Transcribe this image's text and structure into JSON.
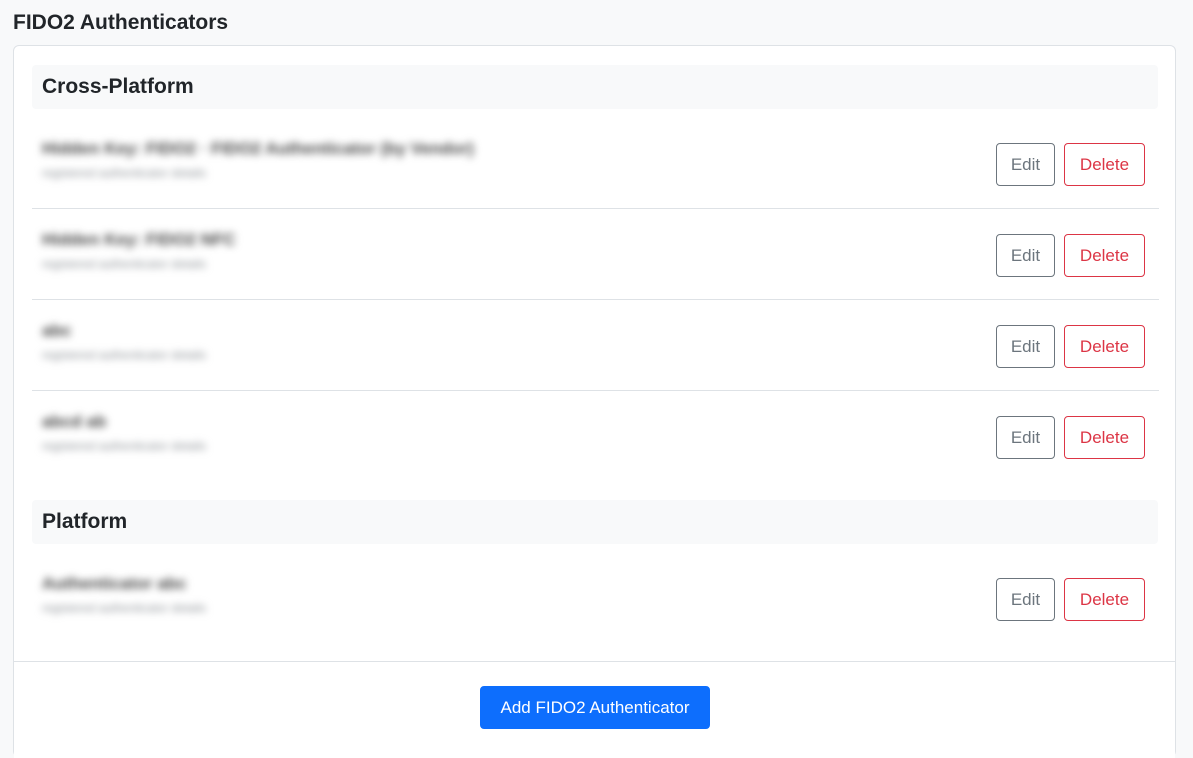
{
  "page": {
    "title": "FIDO2 Authenticators"
  },
  "sections": {
    "cross_platform": {
      "title": "Cross-Platform",
      "items": [
        {
          "name": "Hidden Key: FIDO2 · FIDO2 Authenticator (by Vendor)",
          "meta": "registered authenticator details",
          "edit_label": "Edit",
          "delete_label": "Delete"
        },
        {
          "name": "Hidden Key: FIDO2 NFC",
          "meta": "registered authenticator details",
          "edit_label": "Edit",
          "delete_label": "Delete"
        },
        {
          "name": "abc",
          "meta": "registered authenticator details",
          "edit_label": "Edit",
          "delete_label": "Delete"
        },
        {
          "name": "abcd ab",
          "meta": "registered authenticator details",
          "edit_label": "Edit",
          "delete_label": "Delete"
        }
      ]
    },
    "platform": {
      "title": "Platform",
      "items": [
        {
          "name": "Authenticator abc",
          "meta": "registered authenticator details",
          "edit_label": "Edit",
          "delete_label": "Delete"
        }
      ]
    }
  },
  "footer": {
    "add_label": "Add FIDO2 Authenticator"
  },
  "colors": {
    "primary": "#0d6efd",
    "danger": "#dc3545",
    "secondary": "#6c757d"
  }
}
